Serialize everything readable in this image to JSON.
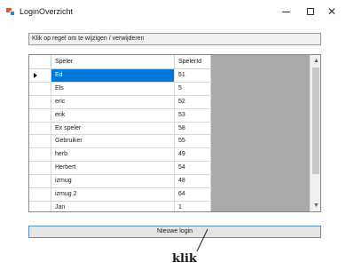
{
  "window": {
    "title": "LoginOverzicht",
    "controls": [
      "minimize-icon",
      "maximize-icon",
      "close-icon"
    ],
    "close_glyph": "✕"
  },
  "hint": "Klik op regel om te wijzigen / verwijderen",
  "grid": {
    "columns": [
      "Speler",
      "SpelerId"
    ],
    "selected_index": 0,
    "rows": [
      {
        "speler": "Ed",
        "id": "51"
      },
      {
        "speler": "Els",
        "id": "5"
      },
      {
        "speler": "eric",
        "id": "52"
      },
      {
        "speler": "erik",
        "id": "53"
      },
      {
        "speler": "Ex speler",
        "id": "58"
      },
      {
        "speler": "Gebruiker",
        "id": "55"
      },
      {
        "speler": "herb",
        "id": "49"
      },
      {
        "speler": "Herbert",
        "id": "54"
      },
      {
        "speler": "izmug",
        "id": "48"
      },
      {
        "speler": "izmug 2",
        "id": "64"
      },
      {
        "speler": "Jan",
        "id": "1"
      }
    ],
    "scroll_up": "▲",
    "scroll_down": "▼"
  },
  "new_button": "Nieuwe login",
  "annotation": "klik",
  "colors": {
    "selection": "#0078d7",
    "grid_background": "#a9a9a9",
    "button_border": "#5a8fd0"
  }
}
